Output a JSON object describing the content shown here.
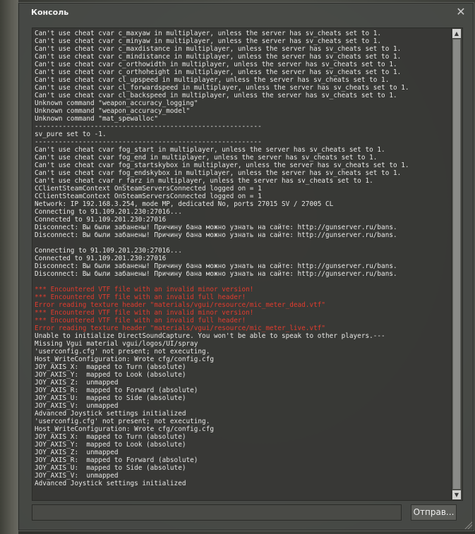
{
  "window": {
    "title": "Консоль",
    "close_glyph": "✕",
    "close_icon": "close-icon"
  },
  "console": {
    "lines": [
      {
        "text": "Can't use cheat cvar c_maxyaw in multiplayer, unless the server has sv_cheats set to 1.",
        "kind": "normal"
      },
      {
        "text": "Can't use cheat cvar c_minyaw in multiplayer, unless the server has sv_cheats set to 1.",
        "kind": "normal"
      },
      {
        "text": "Can't use cheat cvar c_maxdistance in multiplayer, unless the server has sv_cheats set to 1.",
        "kind": "normal"
      },
      {
        "text": "Can't use cheat cvar c_mindistance in multiplayer, unless the server has sv_cheats set to 1.",
        "kind": "normal"
      },
      {
        "text": "Can't use cheat cvar c_orthowidth in multiplayer, unless the server has sv_cheats set to 1.",
        "kind": "normal"
      },
      {
        "text": "Can't use cheat cvar c_orthoheight in multiplayer, unless the server has sv_cheats set to 1.",
        "kind": "normal"
      },
      {
        "text": "Can't use cheat cvar cl_upspeed in multiplayer, unless the server has sv_cheats set to 1.",
        "kind": "normal"
      },
      {
        "text": "Can't use cheat cvar cl_forwardspeed in multiplayer, unless the server has sv_cheats set to 1.",
        "kind": "normal"
      },
      {
        "text": "Can't use cheat cvar cl_backspeed in multiplayer, unless the server has sv_cheats set to 1.",
        "kind": "normal"
      },
      {
        "text": "Unknown command \"weapon_accuracy_logging\"",
        "kind": "normal"
      },
      {
        "text": "Unknown command \"weapon_accuracy_model\"",
        "kind": "normal"
      },
      {
        "text": "Unknown command \"mat_spewalloc\"",
        "kind": "normal"
      },
      {
        "text": "---------------------------------------------------------",
        "kind": "normal"
      },
      {
        "text": "sv_pure set to -1.",
        "kind": "normal"
      },
      {
        "text": "---------------------------------------------------------",
        "kind": "normal"
      },
      {
        "text": "Can't use cheat cvar fog_start in multiplayer, unless the server has sv_cheats set to 1.",
        "kind": "normal"
      },
      {
        "text": "Can't use cheat cvar fog_end in multiplayer, unless the server has sv_cheats set to 1.",
        "kind": "normal"
      },
      {
        "text": "Can't use cheat cvar fog_startskybox in multiplayer, unless the server has sv_cheats set to 1.",
        "kind": "normal"
      },
      {
        "text": "Can't use cheat cvar fog_endskybox in multiplayer, unless the server has sv_cheats set to 1.",
        "kind": "normal"
      },
      {
        "text": "Can't use cheat cvar r_farz in multiplayer, unless the server has sv_cheats set to 1.",
        "kind": "normal"
      },
      {
        "text": "CClientSteamContext OnSteamServersConnected logged on = 1",
        "kind": "normal"
      },
      {
        "text": "CClientSteamContext OnSteamServersConnected logged on = 1",
        "kind": "normal"
      },
      {
        "text": "Network: IP 192.168.3.254, mode MP, dedicated No, ports 27015 SV / 27005 CL",
        "kind": "normal"
      },
      {
        "text": "Connecting to 91.109.201.230:27016...",
        "kind": "normal"
      },
      {
        "text": "Connected to 91.109.201.230:27016",
        "kind": "normal"
      },
      {
        "text": "Disconnect: Вы были забанены! Причину бана можно узнать на сайте: http://gunserver.ru/bans.",
        "kind": "normal"
      },
      {
        "text": "Disconnect: Вы были забанены! Причину бана можно узнать на сайте: http://gunserver.ru/bans.",
        "kind": "normal"
      },
      {
        "text": "",
        "kind": "normal"
      },
      {
        "text": "Connecting to 91.109.201.230:27016...",
        "kind": "normal"
      },
      {
        "text": "Connected to 91.109.201.230:27016",
        "kind": "normal"
      },
      {
        "text": "Disconnect: Вы были забанены! Причину бана можно узнать на сайте: http://gunserver.ru/bans.",
        "kind": "normal"
      },
      {
        "text": "Disconnect: Вы были забанены! Причину бана можно узнать на сайте: http://gunserver.ru/bans.",
        "kind": "normal"
      },
      {
        "text": "",
        "kind": "normal"
      },
      {
        "text": "*** Encountered VTF file with an invalid minor version!",
        "kind": "err"
      },
      {
        "text": "*** Encountered VTF file with an invalid full header!",
        "kind": "err"
      },
      {
        "text": "Error reading texture header \"materials/vgui/resource/mic_meter_dead.vtf\"",
        "kind": "err"
      },
      {
        "text": "*** Encountered VTF file with an invalid minor version!",
        "kind": "err"
      },
      {
        "text": "*** Encountered VTF file with an invalid full header!",
        "kind": "err"
      },
      {
        "text": "Error reading texture header \"materials/vgui/resource/mic_meter_live.vtf\"",
        "kind": "err"
      },
      {
        "text": "Unable to initialize DirectSoundCapture. You won't be able to speak to other players.---",
        "kind": "normal"
      },
      {
        "text": "Missing Vgui material vgui/logos/UI/spray",
        "kind": "normal"
      },
      {
        "text": "'userconfig.cfg' not present; not executing.",
        "kind": "normal"
      },
      {
        "text": "Host_WriteConfiguration: Wrote cfg/config.cfg",
        "kind": "normal"
      },
      {
        "text": "JOY_AXIS_X:  mapped to Turn (absolute)",
        "kind": "normal"
      },
      {
        "text": "JOY_AXIS_Y:  mapped to Look (absolute)",
        "kind": "normal"
      },
      {
        "text": "JOY_AXIS_Z:  unmapped",
        "kind": "normal"
      },
      {
        "text": "JOY_AXIS_R:  mapped to Forward (absolute)",
        "kind": "normal"
      },
      {
        "text": "JOY_AXIS_U:  mapped to Side (absolute)",
        "kind": "normal"
      },
      {
        "text": "JOY_AXIS_V:  unmapped",
        "kind": "normal"
      },
      {
        "text": "Advanced Joystick settings initialized",
        "kind": "normal"
      },
      {
        "text": "'userconfig.cfg' not present; not executing.",
        "kind": "normal"
      },
      {
        "text": "Host_WriteConfiguration: Wrote cfg/config.cfg",
        "kind": "normal"
      },
      {
        "text": "JOY_AXIS_X:  mapped to Turn (absolute)",
        "kind": "normal"
      },
      {
        "text": "JOY_AXIS_Y:  mapped to Look (absolute)",
        "kind": "normal"
      },
      {
        "text": "JOY_AXIS_Z:  unmapped",
        "kind": "normal"
      },
      {
        "text": "JOY_AXIS_R:  mapped to Forward (absolute)",
        "kind": "normal"
      },
      {
        "text": "JOY_AXIS_U:  mapped to Side (absolute)",
        "kind": "normal"
      },
      {
        "text": "JOY_AXIS_V:  unmapped",
        "kind": "normal"
      },
      {
        "text": "Advanced Joystick settings initialized",
        "kind": "normal"
      }
    ],
    "scroll_up_glyph": "▲",
    "scroll_down_glyph": "▼"
  },
  "command": {
    "value": "",
    "submit_label": "Отправ..."
  },
  "colors": {
    "error_text": "#e23c2e",
    "normal_text": "#e8e8e6"
  }
}
